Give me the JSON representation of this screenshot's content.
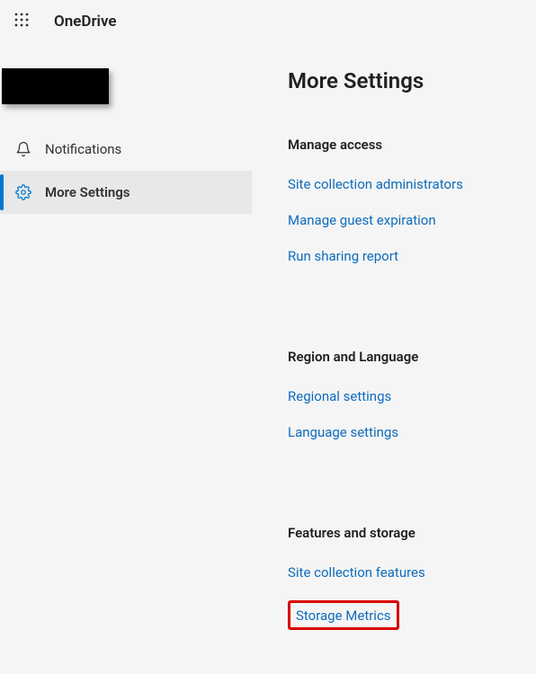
{
  "header": {
    "brand": "OneDrive"
  },
  "sidebar": {
    "items": [
      {
        "label": "Notifications",
        "icon": "bell-icon",
        "active": false
      },
      {
        "label": "More Settings",
        "icon": "gear-icon",
        "active": true
      }
    ]
  },
  "main": {
    "title": "More Settings",
    "sections": [
      {
        "heading": "Manage access",
        "links": [
          {
            "label": "Site collection administrators"
          },
          {
            "label": "Manage guest expiration"
          },
          {
            "label": "Run sharing report"
          }
        ]
      },
      {
        "heading": "Region and Language",
        "links": [
          {
            "label": "Regional settings"
          },
          {
            "label": "Language settings"
          }
        ]
      },
      {
        "heading": "Features and storage",
        "links": [
          {
            "label": "Site collection features"
          },
          {
            "label": "Storage Metrics",
            "highlighted": true
          }
        ]
      }
    ]
  }
}
